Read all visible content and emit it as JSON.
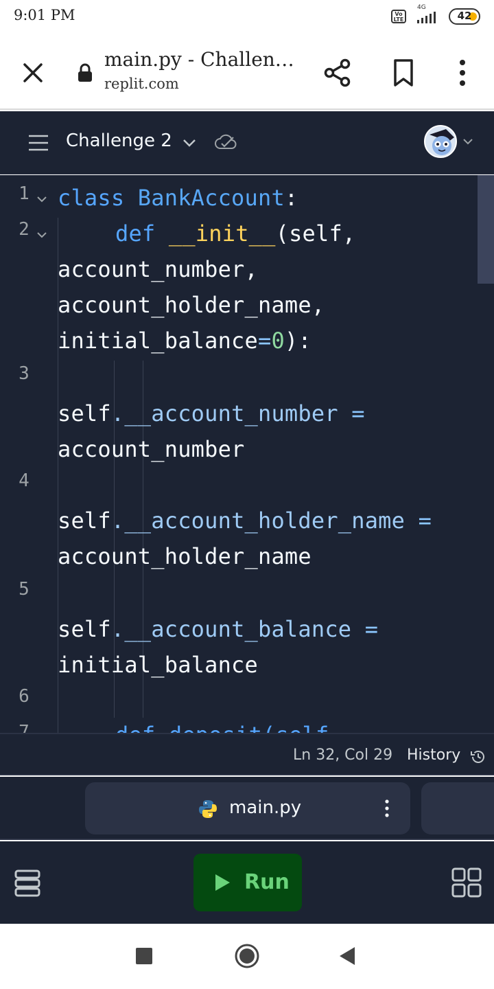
{
  "status_bar": {
    "time": "9:01 PM",
    "network": "4G",
    "volte_label": "Vo LTE",
    "battery": "42"
  },
  "browser": {
    "title": "main.py - Challen…",
    "url": "replit.com",
    "icons": [
      "close-icon",
      "lock-icon",
      "share-icon",
      "bookmark-icon",
      "more-vert-icon"
    ]
  },
  "header": {
    "repl_name": "Challenge 2",
    "icons": [
      "menu-icon",
      "chevron-down-icon",
      "cloud-check-icon",
      "avatar"
    ]
  },
  "editor": {
    "line_numbers": [
      "1",
      "2",
      "3",
      "4",
      "5",
      "6",
      "7"
    ],
    "code": {
      "l1_kw": "class",
      "l1_name": "BankAccount",
      "l1_colon": ":",
      "l2_kw": "def",
      "l2_fn": "__init__",
      "l2_rest": "(self,",
      "l2b": "account_number,",
      "l2c": "account_holder_name,",
      "l2d_name": "initial_balance",
      "l2d_eq": "=",
      "l2d_num": "0",
      "l2d_end": "):",
      "l3_self": "self",
      "l3_attr": ".__account_number",
      "l3_eq": " =",
      "l3b": "account_number",
      "l4_self": "self",
      "l4_attr": ".__account_holder_name",
      "l4_eq": " =",
      "l4b": "account_holder_name",
      "l5_self": "self",
      "l5_attr": ".__account_balance",
      "l5_eq": " =",
      "l5b": "initial_balance",
      "l7_partial": "def deposit(self"
    }
  },
  "status_line": {
    "cursor": "Ln 32, Col 29",
    "history": "History"
  },
  "tabs": [
    {
      "label": "main.py",
      "icon": "python-icon"
    }
  ],
  "toolbar": {
    "run_label": "Run",
    "icons": [
      "layers-icon",
      "play-icon",
      "grid-icon"
    ]
  },
  "colors": {
    "editor_bg": "#1c2333",
    "keyword": "#56a6ff",
    "function": "#ffd35c",
    "attribute": "#9fcbf5",
    "number": "#8fd9a0",
    "run_bg": "#044a10",
    "run_text": "#6ad37a"
  }
}
